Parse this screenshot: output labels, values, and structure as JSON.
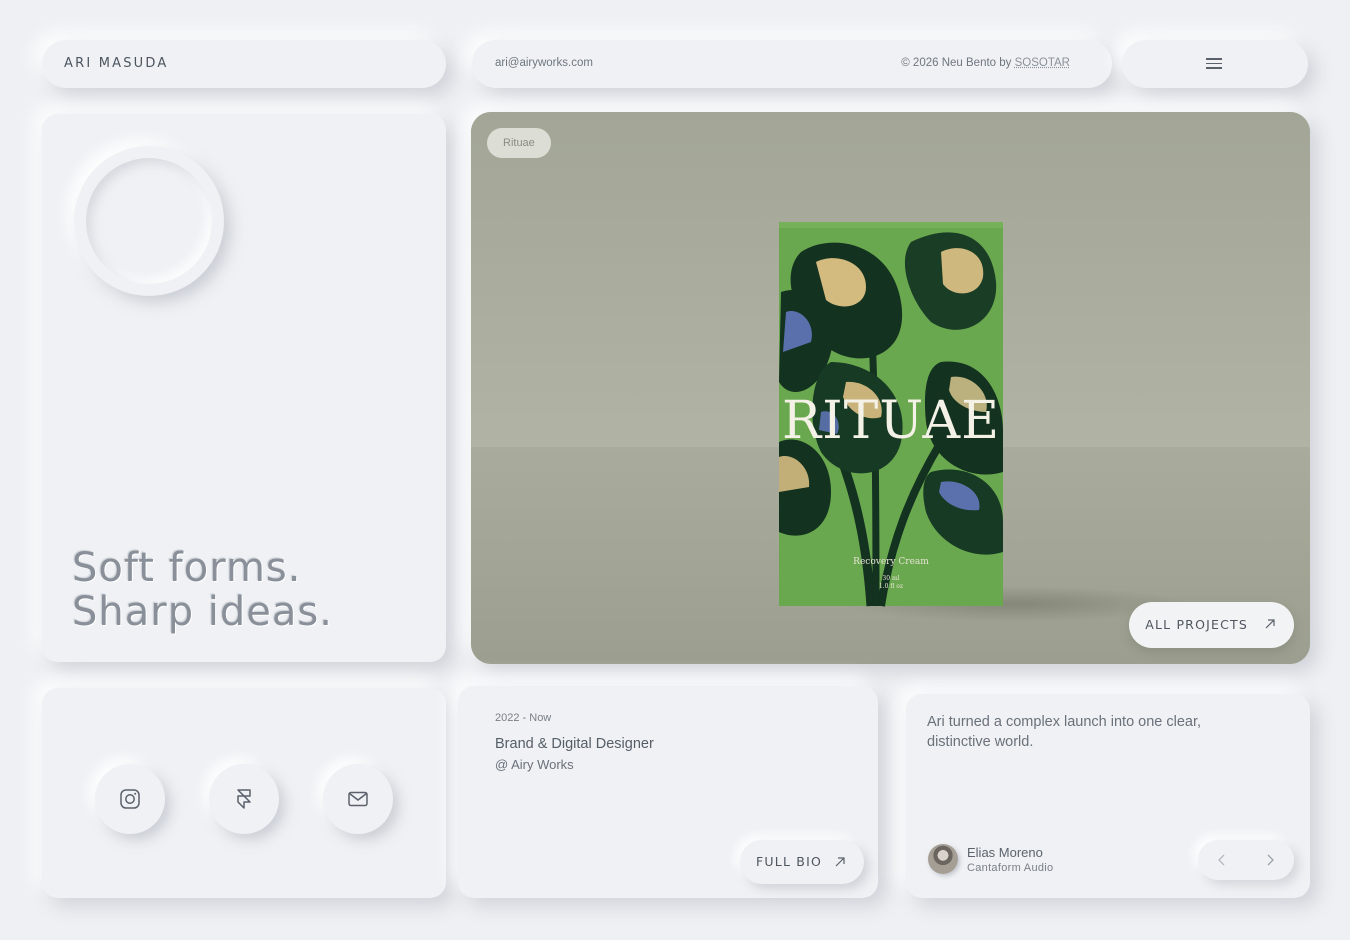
{
  "header": {
    "name": "ARI MASUDA",
    "email": "ari@airyworks.com",
    "credit_prefix": "© 2026 Neu Bento by",
    "credit_link": "SOSOTAR"
  },
  "intro": {
    "tagline_line1": "Soft forms.",
    "tagline_line2": "Sharp ideas."
  },
  "project": {
    "tag": "Rituae",
    "product_brand": "RITUAE",
    "product_name": "Recovery Cream",
    "product_size_1": "30 ml",
    "product_size_2": "1.0 fl oz",
    "all_projects_label": "ALL PROJECTS"
  },
  "socials": [
    {
      "name": "instagram-icon"
    },
    {
      "name": "framer-icon"
    },
    {
      "name": "mail-icon"
    }
  ],
  "bio": {
    "period": "2022 - Now",
    "role": "Brand & Digital Designer",
    "company": "@ Airy Works",
    "full_bio_label": "FULL BIO"
  },
  "testimonial": {
    "quote": "Ari turned a complex launch into one clear, distinctive world.",
    "author": "Elias Moreno",
    "organization": "Cantaform Audio"
  },
  "colors": {
    "background": "#eef0f3",
    "photo_backdrop": "#a7ab9b",
    "box_green": "#6aa84f",
    "leaf_dark": "#13321f"
  }
}
